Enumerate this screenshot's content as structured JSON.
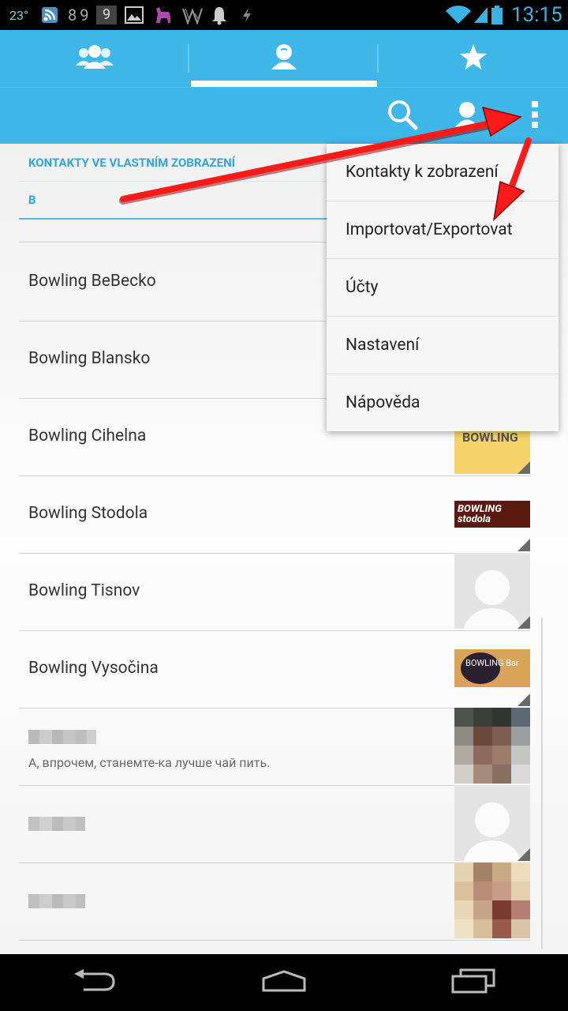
{
  "status_bar": {
    "temperature": "23°",
    "counter": "89",
    "badge_number": "9",
    "clock": "13:15"
  },
  "tabs": [
    {
      "name": "groups",
      "icon": "people-icon",
      "selected": false
    },
    {
      "name": "contacts",
      "icon": "person-icon",
      "selected": true
    },
    {
      "name": "favorites",
      "icon": "star-icon",
      "selected": false
    }
  ],
  "action_bar": {
    "icons": [
      "search-icon",
      "add-contact-icon",
      "overflow-menu-icon"
    ]
  },
  "list": {
    "filter_header": "KONTAKTY VE VLASTNÍM ZOBRAZENÍ",
    "section_letter": "B",
    "contacts": [
      {
        "name": "Bowling BeBecko",
        "status": ""
      },
      {
        "name": "Bowling Blansko",
        "status": ""
      },
      {
        "name": "Bowling Cihelna",
        "status": "",
        "photo_text": "BOWLING"
      },
      {
        "name": "Bowling Stodola",
        "status": "",
        "photo_text": "BOWLING stodola"
      },
      {
        "name": "Bowling Tisnov",
        "status": ""
      },
      {
        "name": "Bowling Vysočina",
        "status": "",
        "photo_text": "BOWLING Bar"
      },
      {
        "name": "",
        "status": "А, впрочем, станемте-ка лучше чай пить."
      },
      {
        "name": "",
        "status": ""
      },
      {
        "name": "",
        "status": ""
      }
    ]
  },
  "menu": {
    "items": [
      "Kontakty k zobrazení",
      "Importovat/Exportovat",
      "Účty",
      "Nastavení",
      "Nápověda"
    ]
  },
  "nav_bar": {
    "buttons": [
      "back-icon",
      "home-icon",
      "recent-apps-icon"
    ]
  },
  "colors": {
    "accent": "#3fb7e8",
    "header_text": "#33a5db",
    "arrow": "#ff1a1a"
  }
}
